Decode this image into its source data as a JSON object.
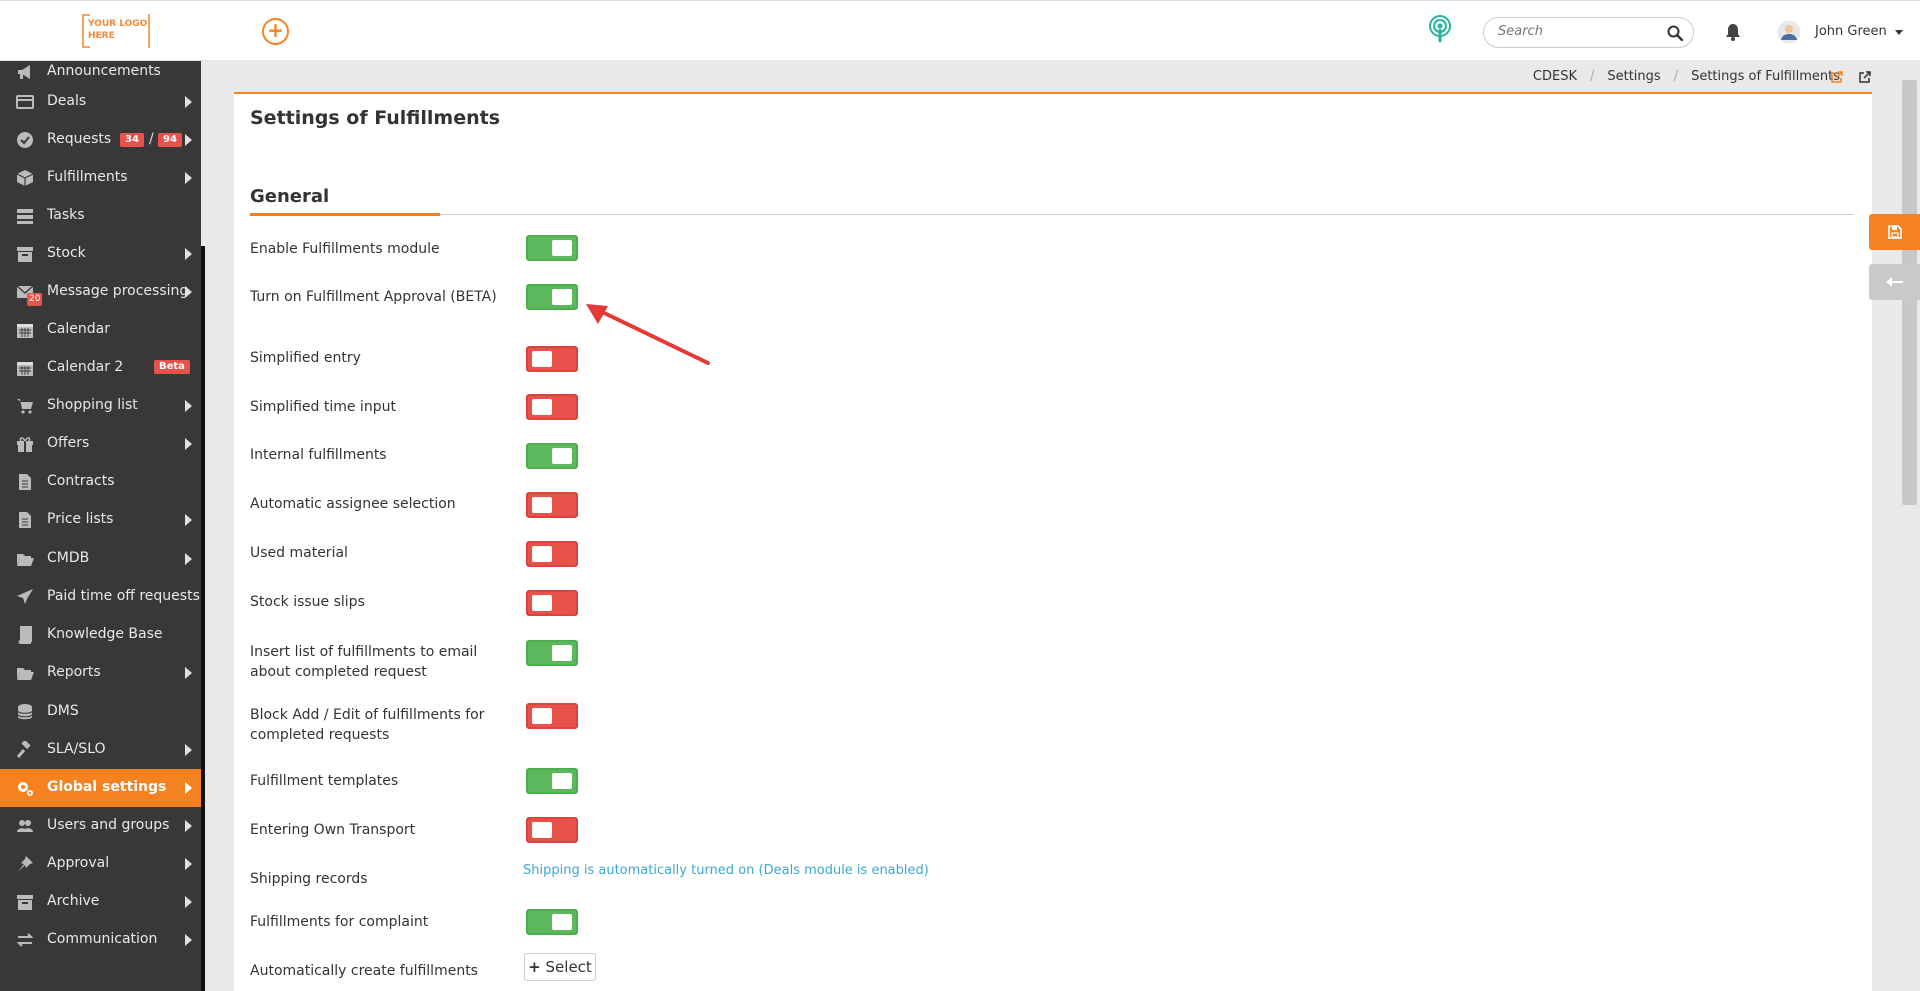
{
  "logo": {
    "line1": "YOUR LOGO",
    "line2": "HERE"
  },
  "header": {
    "add_symbol": "+",
    "search_placeholder": "Search",
    "username": "John Green"
  },
  "sidebar": {
    "items": [
      {
        "label": "Announcements",
        "icon": "megaphone-icon",
        "arrow": false
      },
      {
        "label": "Deals",
        "icon": "card-icon",
        "arrow": true
      },
      {
        "label": "Requests",
        "icon": "check-circle-icon",
        "arrow": true,
        "badge1": "34",
        "sep": "/",
        "badge2": "94"
      },
      {
        "label": "Fulfillments",
        "icon": "box-icon",
        "arrow": true
      },
      {
        "label": "Tasks",
        "icon": "tasks-icon",
        "arrow": false
      },
      {
        "label": "Stock",
        "icon": "archive-icon",
        "arrow": true
      },
      {
        "label": "Message processing",
        "icon": "envelope-icon",
        "arrow": true,
        "mini_badge": "20"
      },
      {
        "label": "Calendar",
        "icon": "calendar-icon",
        "arrow": false
      },
      {
        "label": "Calendar 2",
        "icon": "calendar-icon",
        "arrow": false,
        "tag": "Beta"
      },
      {
        "label": "Shopping list",
        "icon": "cart-icon",
        "arrow": true
      },
      {
        "label": "Offers",
        "icon": "gift-icon",
        "arrow": true
      },
      {
        "label": "Contracts",
        "icon": "document-icon",
        "arrow": false
      },
      {
        "label": "Price lists",
        "icon": "document-icon",
        "arrow": true
      },
      {
        "label": "CMDB",
        "icon": "folder-open-icon",
        "arrow": true
      },
      {
        "label": "Paid time off requests",
        "icon": "plane-icon",
        "arrow": false
      },
      {
        "label": "Knowledge Base",
        "icon": "book-icon",
        "arrow": false
      },
      {
        "label": "Reports",
        "icon": "folder-open-icon",
        "arrow": true
      },
      {
        "label": "DMS",
        "icon": "database-icon",
        "arrow": false
      },
      {
        "label": "SLA/SLO",
        "icon": "gavel-icon",
        "arrow": true
      },
      {
        "label": "Global settings",
        "icon": "gears-icon",
        "arrow": true,
        "active": true
      },
      {
        "label": "Users and groups",
        "icon": "users-icon",
        "arrow": true
      },
      {
        "label": "Approval",
        "icon": "thumbtack-icon",
        "arrow": true
      },
      {
        "label": "Archive",
        "icon": "archive-icon",
        "arrow": true
      },
      {
        "label": "Communication",
        "icon": "exchange-icon",
        "arrow": true
      }
    ]
  },
  "breadcrumb": {
    "items": [
      "CDESK",
      "Settings",
      "Settings of Fulfillments"
    ]
  },
  "page": {
    "title": "Settings of Fulfillments",
    "section": "General"
  },
  "settings": [
    {
      "label": "Enable Fulfillments module",
      "state": "on"
    },
    {
      "label": "Turn on Fulfillment Approval (BETA)",
      "state": "on"
    },
    {
      "label": "Simplified entry",
      "state": "off"
    },
    {
      "label": "Simplified time input",
      "state": "off"
    },
    {
      "label": "Internal fulfillments",
      "state": "on"
    },
    {
      "label": "Automatic assignee selection",
      "state": "off"
    },
    {
      "label": "Used material",
      "state": "off"
    },
    {
      "label": "Stock issue slips",
      "state": "off"
    },
    {
      "label": "Insert list of fulfillments to email about completed request",
      "state": "on"
    },
    {
      "label": "Block Add / Edit of fulfillments for completed requests",
      "state": "off"
    },
    {
      "label": "Fulfillment templates",
      "state": "on"
    },
    {
      "label": "Entering Own Transport",
      "state": "off"
    },
    {
      "label": "Shipping records",
      "state": "note"
    },
    {
      "label": "Fulfillments for complaint",
      "state": "on"
    },
    {
      "label": "Automatically create fulfillments",
      "state": "select"
    }
  ],
  "shipping_note": "Shipping is automatically turned on (Deals module is enabled)",
  "select_button": {
    "symbol": "+",
    "label": "Select"
  },
  "colors": {
    "accent": "#f58220",
    "toggle_on": "#5cb85c",
    "toggle_off": "#e9524a",
    "sidebar": "#383838",
    "link": "#3da7d4"
  }
}
